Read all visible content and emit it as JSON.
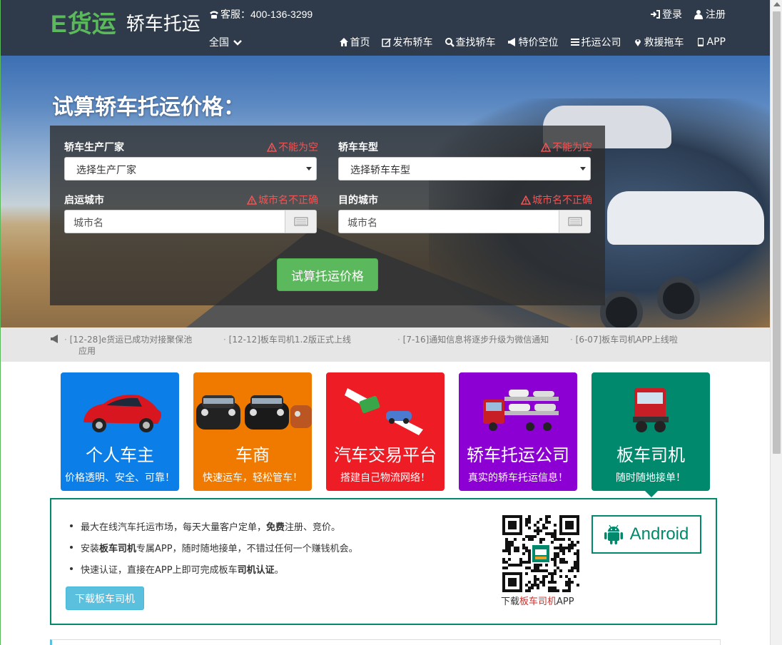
{
  "header": {
    "logo_e": "E",
    "logo_main": "货运",
    "logo_sub": "轿车托运",
    "hotline": "客服：400-136-3299",
    "region": "全国",
    "auth": [
      {
        "label": "登录",
        "icon": "sign-in-icon"
      },
      {
        "label": "注册",
        "icon": "user-icon"
      }
    ],
    "nav": [
      {
        "label": "首页",
        "icon": "home-icon"
      },
      {
        "label": "发布轿车",
        "icon": "edit-icon"
      },
      {
        "label": "查找轿车",
        "icon": "search-icon"
      },
      {
        "label": "特价空位",
        "icon": "bullhorn-icon"
      },
      {
        "label": "托运公司",
        "icon": "list-icon"
      },
      {
        "label": "救援拖车",
        "icon": "map-marker-icon"
      },
      {
        "label": "APP",
        "icon": "mobile-icon"
      }
    ]
  },
  "hero": {
    "title": "试算轿车托运价格：",
    "maker": {
      "label": "轿车生产厂家",
      "error": "不能为空",
      "value": "选择生产厂家"
    },
    "model": {
      "label": "轿车车型",
      "error": "不能为空",
      "value": "选择轿车车型"
    },
    "origin": {
      "label": "启运城市",
      "error": "城市名不正确",
      "placeholder": "城市名"
    },
    "destination": {
      "label": "目的城市",
      "error": "城市名不正确",
      "placeholder": "城市名"
    },
    "submit": "试算托运价格"
  },
  "news": [
    "[12-28]e货运已成功对接聚保池应用",
    "[12-12]板车司机1.2版正式上线",
    "[7-16]通知信息将逐步升级为微信通知",
    "[6-07]板车司机APP上线啦"
  ],
  "cards": [
    {
      "title": "个人车主",
      "desc": "价格透明、安全、可靠！",
      "color": "#0b7ee8"
    },
    {
      "title": "车商",
      "desc": "快速运车，轻松管车！",
      "color": "#f07a00"
    },
    {
      "title": "汽车交易平台",
      "desc": "搭建自己物流网络！",
      "color": "#ee1c25"
    },
    {
      "title": "轿车托运公司",
      "desc": "真实的轿车托运信息！",
      "color": "#8c00d4"
    },
    {
      "title": "板车司机",
      "desc": "随时随地接单！",
      "color": "#00896d"
    }
  ],
  "panel": {
    "bullets": [
      {
        "pre": "最大在线汽车托运市场，每天大量客户定单，",
        "bold": "免费",
        "post": "注册、竞价。"
      },
      {
        "pre": "安装",
        "bold": "板车司机",
        "post": "专属APP，随时随地接单，不错过任何一个赚钱机会。"
      },
      {
        "pre": "快速认证，直接在APP上即可完成板车",
        "bold": "司机认证",
        "post": "。"
      }
    ],
    "download_button": "下载板车司机",
    "qr_caption_pre": "下载",
    "qr_caption_red": "板车司机",
    "qr_caption_post": "APP",
    "android_label": "Android"
  }
}
